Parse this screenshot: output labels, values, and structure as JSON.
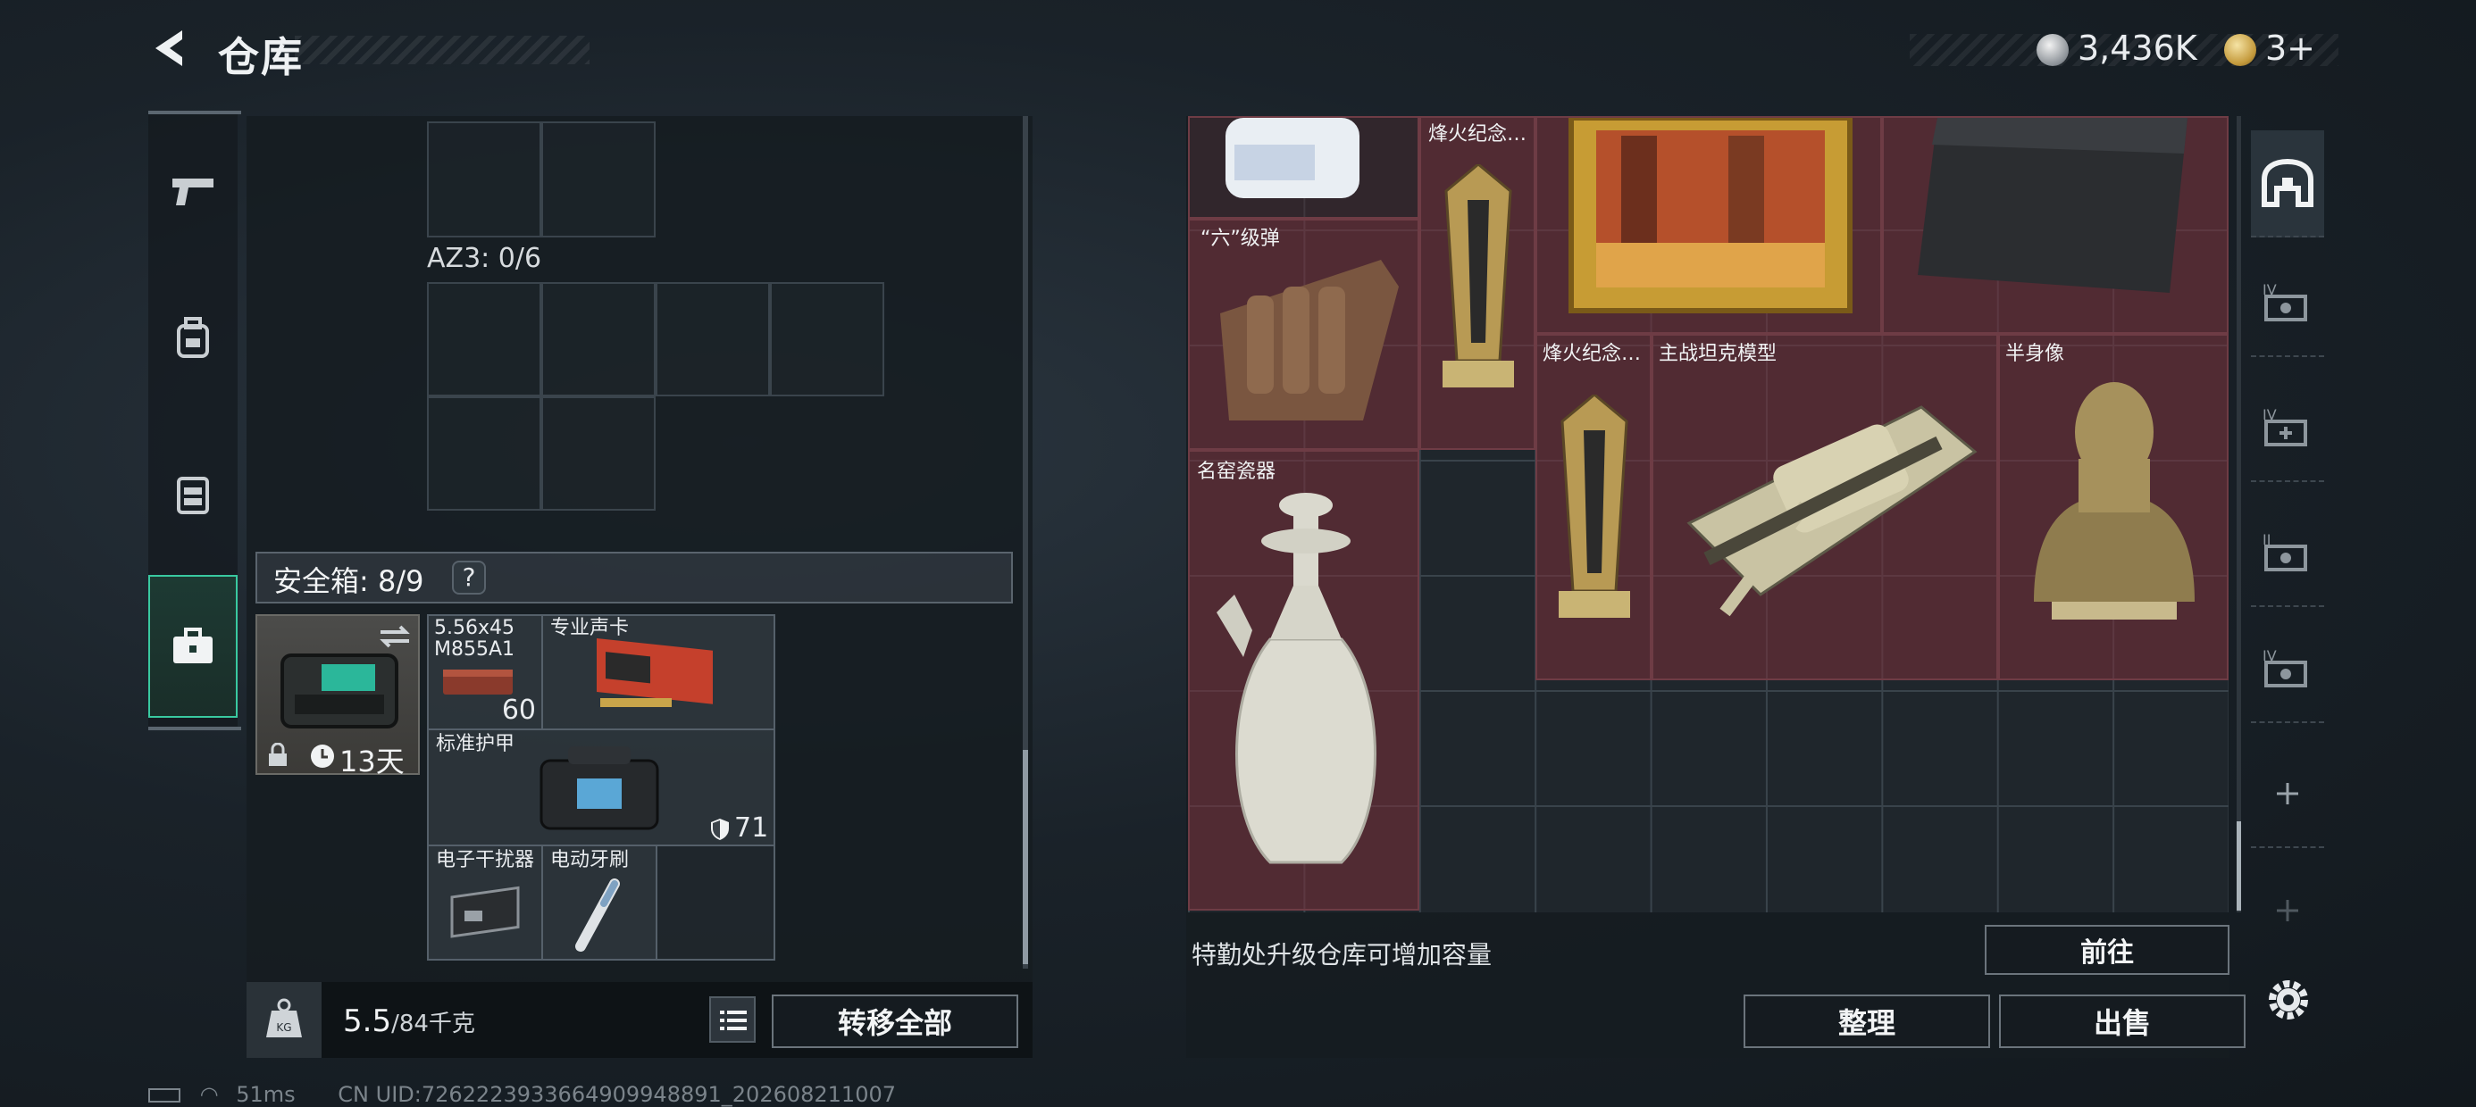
{
  "header": {
    "title": "仓库",
    "currency_1": "3,436K",
    "currency_2": "3+"
  },
  "left_tabs": [
    "weapon-tab",
    "backpack-tab",
    "vest-tab",
    "safebox-tab"
  ],
  "az3": {
    "label": "AZ3: 0/6"
  },
  "safebox": {
    "label": "安全箱: 8/9",
    "help": "?",
    "timer": "13天"
  },
  "items_left": {
    "ammo_name": "5.56x45\nM855A1",
    "ammo_count": "60",
    "gpu_name": "专业声卡",
    "armor_name": "标准护甲",
    "armor_value": "71",
    "jammer_name": "电子干扰器",
    "toothbrush_name": "电动牙刷"
  },
  "footer_left": {
    "weight_value": "5.5",
    "weight_max": "/84千克",
    "transfer_all": "转移全部"
  },
  "items_right": {
    "ammo_six": "“六”级弹",
    "beacon_top": "烽火纪念…",
    "beacon_mid": "烽火纪念…",
    "tank": "主战坦克模型",
    "bust": "半身像",
    "vase": "名窑瓷器"
  },
  "footer_right": {
    "hint": "特勤处升级仓库可增加容量",
    "goto": "前往",
    "organize": "整理",
    "sell": "出售"
  },
  "status": {
    "ping": "51ms",
    "uid": "CN UID:7262223933664909948891_202608211007"
  },
  "colors": {
    "accent": "#39c9a0",
    "highlight_cell": "#7a303a"
  }
}
